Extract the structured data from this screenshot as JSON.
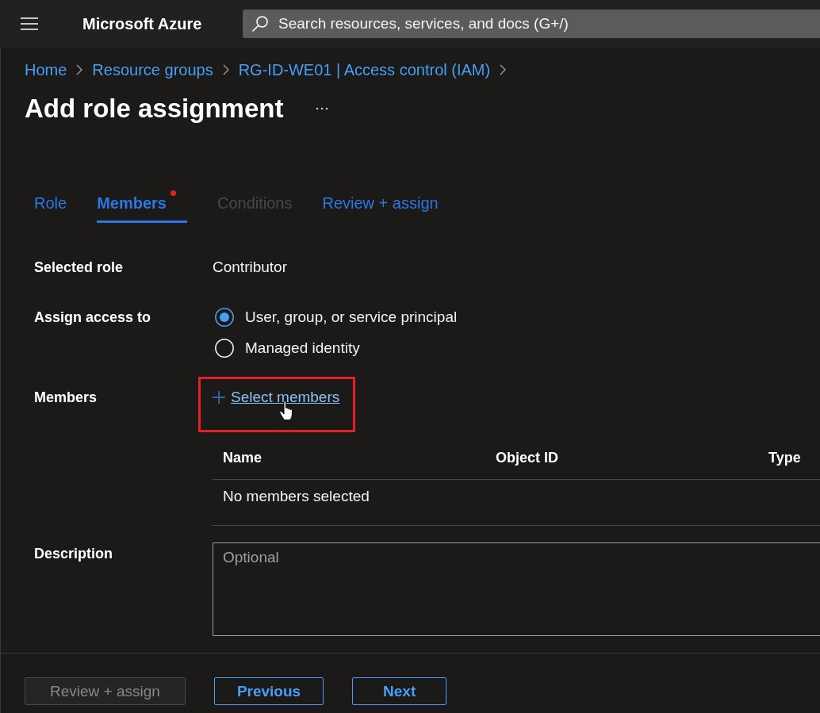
{
  "top_bar": {
    "title": "Microsoft Azure",
    "search": {
      "placeholder": "Search resources, services, and docs (G+/)"
    }
  },
  "breadcrumb": [
    "Home",
    "Resource groups",
    "RG-ID-WE01 | Access control (IAM)"
  ],
  "page": {
    "title": "Add role assignment"
  },
  "tabs": [
    {
      "label": "Role",
      "selected": false,
      "disabled": false,
      "required": false
    },
    {
      "label": "Members",
      "selected": true,
      "disabled": false,
      "required": true
    },
    {
      "label": "Conditions",
      "selected": false,
      "disabled": true,
      "required": false
    },
    {
      "label": "Review + assign",
      "selected": false,
      "disabled": false,
      "required": false
    }
  ],
  "form": {
    "selected_role": {
      "label": "Selected role",
      "value": "Contributor"
    },
    "assign_access": {
      "label": "Assign access to",
      "options": [
        {
          "label": "User, group, or service principal",
          "selected": true
        },
        {
          "label": "Managed identity",
          "selected": false
        }
      ]
    },
    "members": {
      "label": "Members",
      "link": "Select members",
      "highlighted": true,
      "table": {
        "columns": [
          "Name",
          "Object ID",
          "Type"
        ],
        "empty_message": "No members selected"
      }
    },
    "description": {
      "label": "Description",
      "placeholder": "Optional"
    }
  },
  "buttons": [
    {
      "label": "Review + assign",
      "disabled": true
    },
    {
      "label": "Previous",
      "disabled": false
    },
    {
      "label": "Next",
      "disabled": false
    }
  ]
}
